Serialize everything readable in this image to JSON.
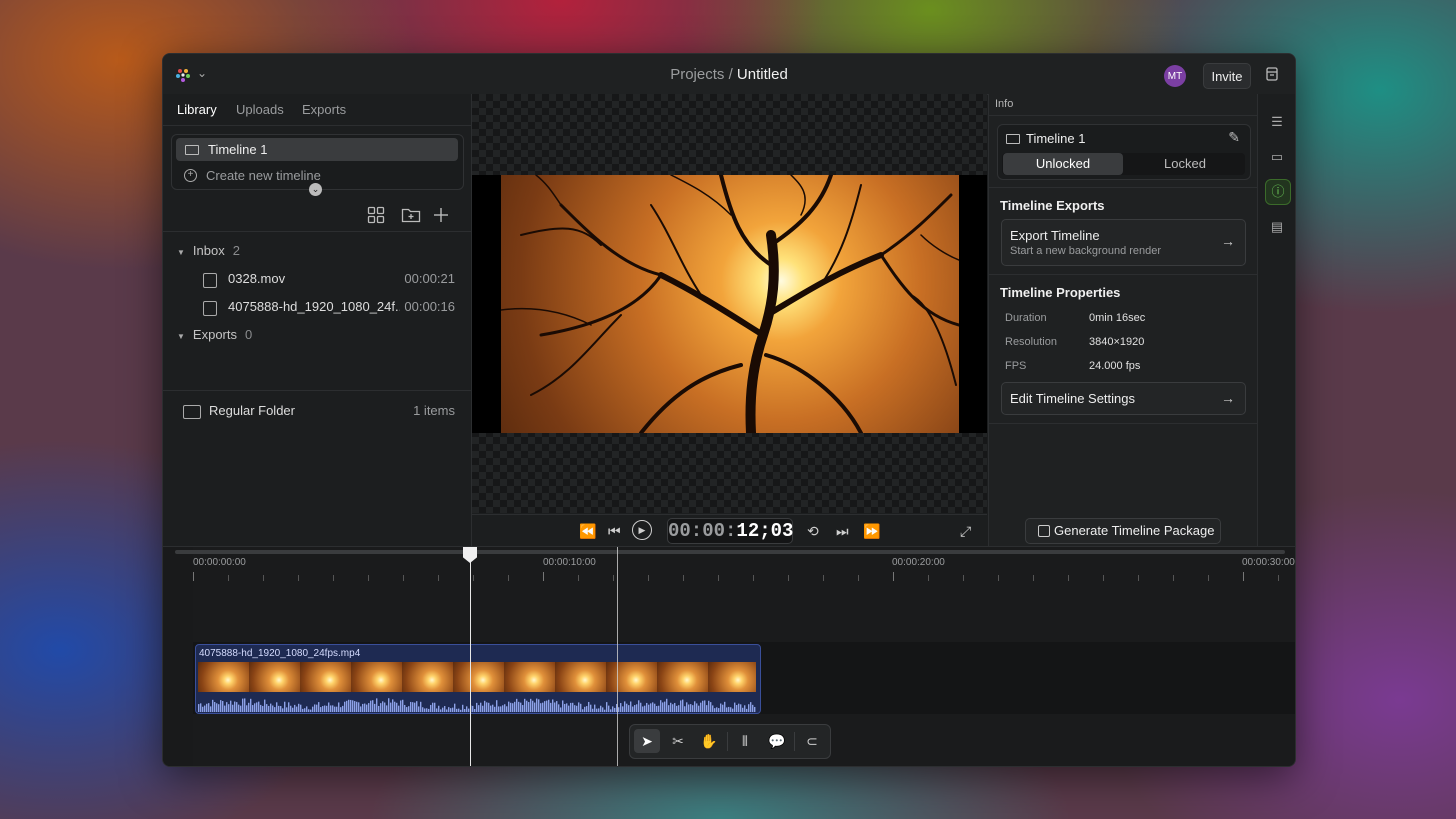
{
  "header": {
    "breadcrumb_root": "Projects /",
    "project_title": "Untitled",
    "avatar_initials": "MT",
    "invite_label": "Invite"
  },
  "library": {
    "tabs": [
      "Library",
      "Uploads",
      "Exports"
    ],
    "active_tab": "Library",
    "timeline_item": "Timeline 1",
    "create_timeline": "Create new timeline",
    "inbox": {
      "label": "Inbox",
      "count": "2"
    },
    "files": [
      {
        "name": "0328.mov",
        "duration": "00:00:21"
      },
      {
        "name": "4075888-hd_1920_1080_24f...",
        "duration": "00:00:16"
      }
    ],
    "exports": {
      "label": "Exports",
      "count": "0"
    },
    "folder": {
      "name": "Regular Folder",
      "count": "1 items"
    }
  },
  "player": {
    "timecode_dim": "00:00:",
    "timecode_bright": "12;03"
  },
  "info_panel": {
    "heading": "Info",
    "timeline_name": "Timeline 1",
    "lock_options": [
      "Unlocked",
      "Locked"
    ],
    "selected_lock": "Unlocked",
    "exports_title": "Timeline Exports",
    "export_button_title": "Export Timeline",
    "export_button_subtitle": "Start a new background render",
    "properties_title": "Timeline Properties",
    "properties": [
      {
        "key": "Duration",
        "value": "0min 16sec"
      },
      {
        "key": "Resolution",
        "value": "3840×1920"
      },
      {
        "key": "FPS",
        "value": "24.000 fps"
      }
    ],
    "edit_settings_label": "Edit Timeline Settings",
    "generate_package_label": "Generate Timeline Package"
  },
  "timeline": {
    "ruler_labels": [
      "00:00:00:00",
      "00:00:10:00",
      "00:00:20:00",
      "00:00:30:00"
    ],
    "clip_name": "4075888-hd_1920_1080_24fps.mp4",
    "playhead_time": "00:00:12;03"
  },
  "icons": {
    "tools": [
      "pointer-icon",
      "razor-icon",
      "hand-icon",
      "split-icon",
      "comment-icon",
      "magnet-icon"
    ],
    "rail": [
      "sliders-icon",
      "comments-icon",
      "info-icon",
      "package-icon"
    ]
  },
  "colors": {
    "accent_green": "#6fcf5b",
    "clip_blue": "#3a4f9a",
    "avatar_purple": "#7b3fa3"
  }
}
